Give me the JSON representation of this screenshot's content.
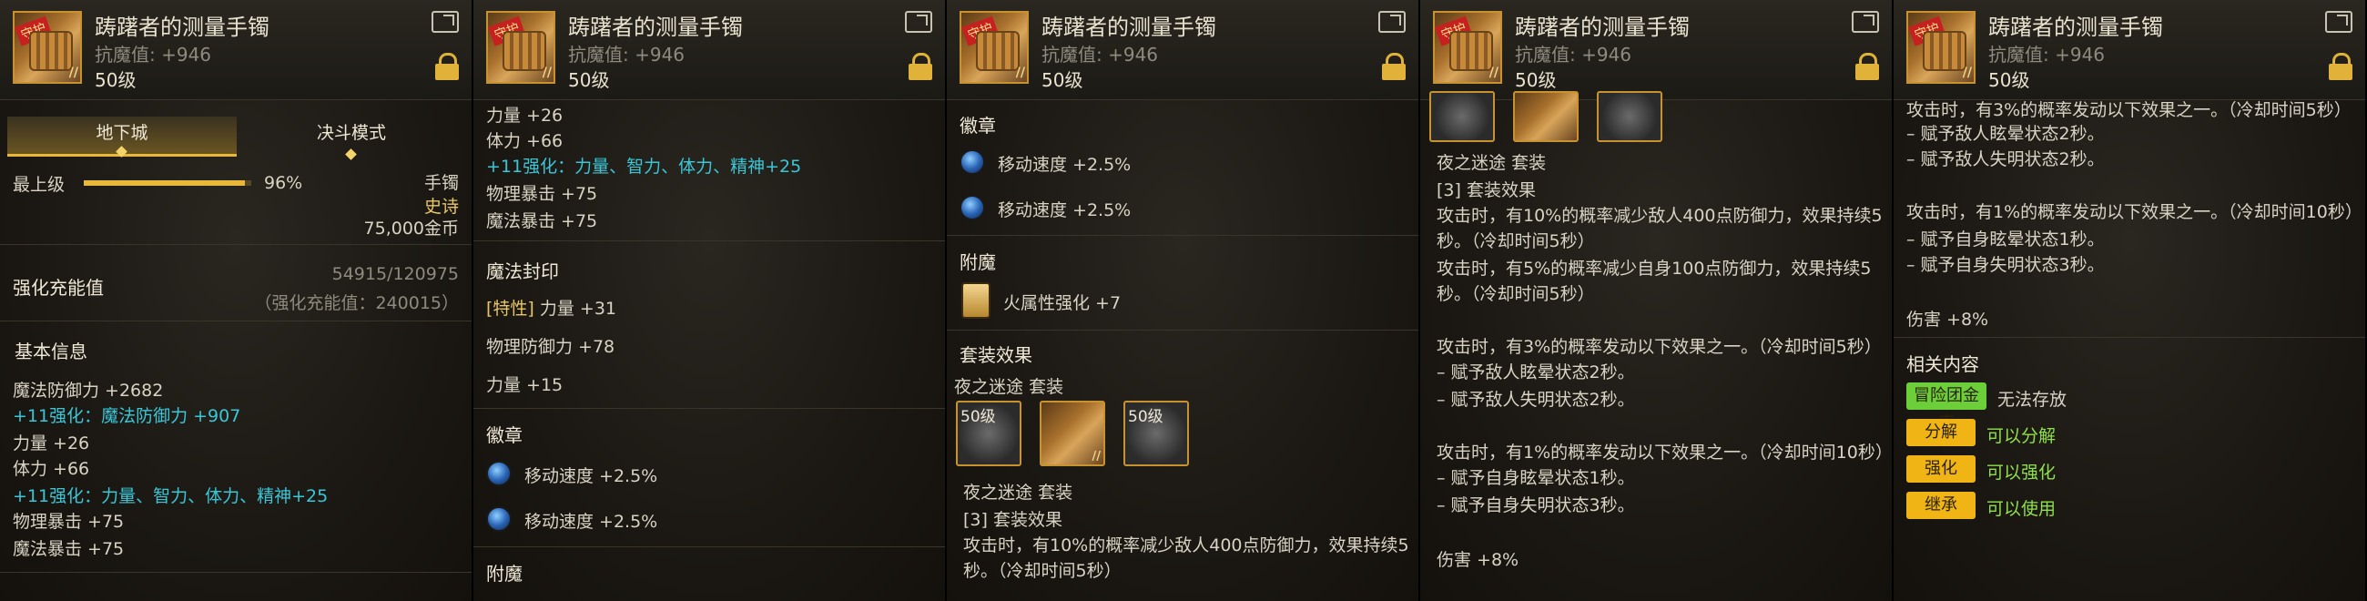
{
  "item": {
    "name": "踌躇者的测量手镯",
    "resistance": "抗魔值: +946",
    "level": "50级",
    "badge": "守护"
  },
  "p1": {
    "tabs": [
      "地下城",
      "决斗模式"
    ],
    "grade_label": "最上级",
    "grade_percent": "96%",
    "grade_fill": 0.96,
    "slot_type": "手镯",
    "rarity": "史诗",
    "price": "75,000金币",
    "enhance_label": "强化充能值",
    "enhance_value": "54915/120975",
    "enhance_sub": "（强化充能值：240015）",
    "basic_info": "基本信息",
    "lines": [
      "魔法防御力 +2682",
      "+11强化：魔法防御力 +907",
      "力量 +26",
      "体力 +66",
      "+11强化：力量、智力、体力、精神+25",
      "物理暴击 +75",
      "魔法暴击 +75"
    ]
  },
  "p2": {
    "lines": [
      "力量 +26",
      "体力 +66",
      "+11强化：力量、智力、体力、精神+25",
      "物理暴击 +75",
      "魔法暴击 +75"
    ],
    "seal_title": "魔法封印",
    "seal_tag": "[特性]",
    "seal_main": "力量 +31",
    "seal_lines": [
      "物理防御力 +78",
      "力量 +15"
    ],
    "emblem_title": "徽章",
    "emblems": [
      "移动速度 +2.5%",
      "移动速度 +2.5%"
    ],
    "enchant_title": "附魔"
  },
  "p3": {
    "emblem_title": "徽章",
    "emblems": [
      "移动速度 +2.5%",
      "移动速度 +2.5%"
    ],
    "enchant_title": "附魔",
    "enchant": "火属性强化 +7",
    "set_title": "套装效果",
    "set_name": "夜之迷途",
    "set_suffix": "套装",
    "slot_level": "50级",
    "set_name2": "夜之迷途",
    "set_count": "[3] 套装效果",
    "lines": [
      "攻击时，有10%的概率减少敌人400点防御力，效果持续5",
      "秒。（冷却时间5秒）"
    ]
  },
  "p4": {
    "set_name": "夜之迷途",
    "set_suffix": "套装",
    "set_count": "[3] 套装效果",
    "lines": [
      "攻击时，有10%的概率减少敌人400点防御力，效果持续5",
      "秒。（冷却时间5秒）",
      "攻击时，有5%的概率减少自身100点防御力，效果持续5",
      "秒。（冷却时间5秒）",
      "攻击时，有3%的概率发动以下效果之一。（冷却时间5秒）",
      "– 赋予敌人眩晕状态2秒。",
      "– 赋予敌人失明状态2秒。",
      "攻击时，有1%的概率发动以下效果之一。（冷却时间10秒）",
      "– 赋予自身眩晕状态1秒。",
      "– 赋予自身失明状态3秒。",
      "伤害 +8%"
    ]
  },
  "p5": {
    "lines": [
      "攻击时，有3%的概率发动以下效果之一。（冷却时间5秒）",
      "– 赋予敌人眩晕状态2秒。",
      "– 赋予敌人失明状态2秒。",
      "攻击时，有1%的概率发动以下效果之一。（冷却时间10秒）",
      "– 赋予自身眩晕状态1秒。",
      "– 赋予自身失明状态3秒。",
      "伤害 +8%"
    ],
    "related_title": "相关内容",
    "related": [
      {
        "chip": "冒险团金库",
        "text": "无法存放"
      },
      {
        "chip": "分解",
        "text": "可以分解"
      },
      {
        "chip": "强化",
        "text": "可以强化"
      },
      {
        "chip": "继承",
        "text": "可以使用"
      }
    ]
  }
}
